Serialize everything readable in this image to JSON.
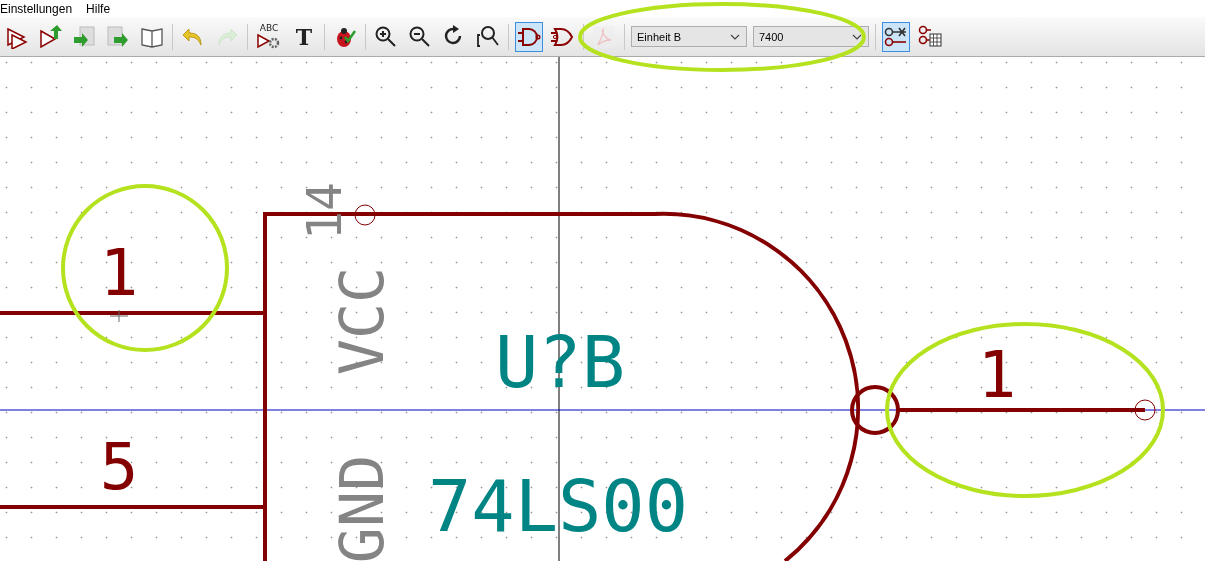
{
  "menu": [
    {
      "label": "Einstellungen"
    },
    {
      "label": "Hilfe"
    }
  ],
  "toolbar": [
    {
      "kind": "amp-plus",
      "selected": false,
      "disabled": false
    },
    {
      "kind": "amp-up",
      "selected": false,
      "disabled": false
    },
    {
      "kind": "import",
      "selected": false,
      "disabled": false
    },
    {
      "kind": "export",
      "selected": false,
      "disabled": false
    },
    {
      "kind": "book",
      "selected": false,
      "disabled": false
    },
    {
      "kind": "separator"
    },
    {
      "kind": "undo",
      "selected": false,
      "disabled": false
    },
    {
      "kind": "redo",
      "selected": false,
      "disabled": true
    },
    {
      "kind": "separator"
    },
    {
      "kind": "abc",
      "selected": false,
      "disabled": false,
      "label": "ABC"
    },
    {
      "kind": "text",
      "selected": false,
      "disabled": false,
      "label": "T"
    },
    {
      "kind": "separator"
    },
    {
      "kind": "bug",
      "selected": false,
      "disabled": false
    },
    {
      "kind": "separator"
    },
    {
      "kind": "zoom-in",
      "selected": false,
      "disabled": false
    },
    {
      "kind": "zoom-out",
      "selected": false,
      "disabled": false
    },
    {
      "kind": "redraw",
      "selected": false,
      "disabled": false
    },
    {
      "kind": "zoom-fit",
      "selected": false,
      "disabled": false
    },
    {
      "kind": "separator"
    },
    {
      "kind": "nand",
      "selected": true,
      "disabled": false
    },
    {
      "kind": "nor",
      "selected": false,
      "disabled": false
    },
    {
      "kind": "separator"
    },
    {
      "kind": "pdf",
      "selected": false,
      "disabled": true
    },
    {
      "kind": "separator"
    },
    {
      "kind": "select",
      "value": "Einheit B"
    },
    {
      "kind": "select",
      "value": "7400"
    },
    {
      "kind": "separator"
    },
    {
      "kind": "pin-toggle",
      "selected": true,
      "disabled": false
    },
    {
      "kind": "pin-table",
      "selected": false,
      "disabled": false
    }
  ],
  "canvas": {
    "pins": [
      {
        "kind": "left",
        "number": "1"
      },
      {
        "kind": "left",
        "number": "5"
      },
      {
        "kind": "right",
        "number": "1"
      }
    ],
    "pin_names": [
      {
        "kind": "top",
        "name": "VCC",
        "number": "14"
      },
      {
        "kind": "bottom",
        "name": "GND"
      }
    ],
    "reference": "U?B",
    "value": "74LS00"
  }
}
